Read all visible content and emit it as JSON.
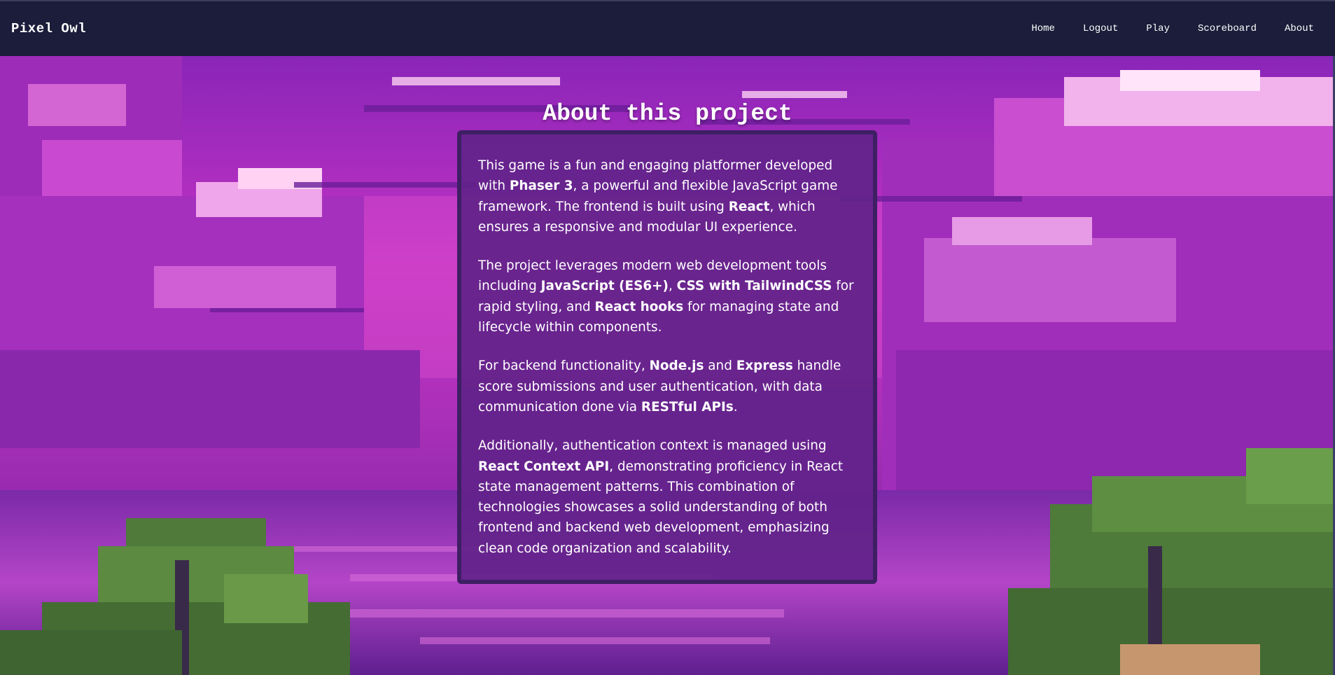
{
  "brand": "Pixel Owl",
  "nav": {
    "home": "Home",
    "logout": "Logout",
    "play": "Play",
    "scoreboard": "Scoreboard",
    "about": "About"
  },
  "page": {
    "title": "About this project"
  },
  "paragraphs": {
    "p1": {
      "a": "This game is a fun and engaging platformer developed with ",
      "b": "Phaser 3",
      "c": ", a powerful and flexible JavaScript game framework. The frontend is built using ",
      "d": "React",
      "e": ", which ensures a responsive and modular UI experience."
    },
    "p2": {
      "a": "The project leverages modern web development tools including ",
      "b": "JavaScript (ES6+)",
      "c": ", ",
      "d": "CSS with TailwindCSS",
      "e": " for rapid styling, and ",
      "f": "React hooks",
      "g": " for managing state and lifecycle within components."
    },
    "p3": {
      "a": "For backend functionality, ",
      "b": "Node.js",
      "c": " and ",
      "d": "Express",
      "e": " handle score submissions and user authentication, with data communication done via ",
      "f": "RESTful APIs",
      "g": "."
    },
    "p4": {
      "a": "Additionally, authentication context is managed using ",
      "b": "React Context API",
      "c": ", demonstrating proficiency in React state management patterns. This combination of technologies showcases a solid understanding of both frontend and backend web development, emphasizing clean code organization and scalability."
    }
  },
  "colors": {
    "navbar": "#1b1d3a",
    "card": "#62228a",
    "card_border": "#3e1f63",
    "sky_top": "#7a1fa8",
    "sky_mid": "#d63cc8",
    "water": "#8c2fb0",
    "trees": "#4e7a3a"
  }
}
